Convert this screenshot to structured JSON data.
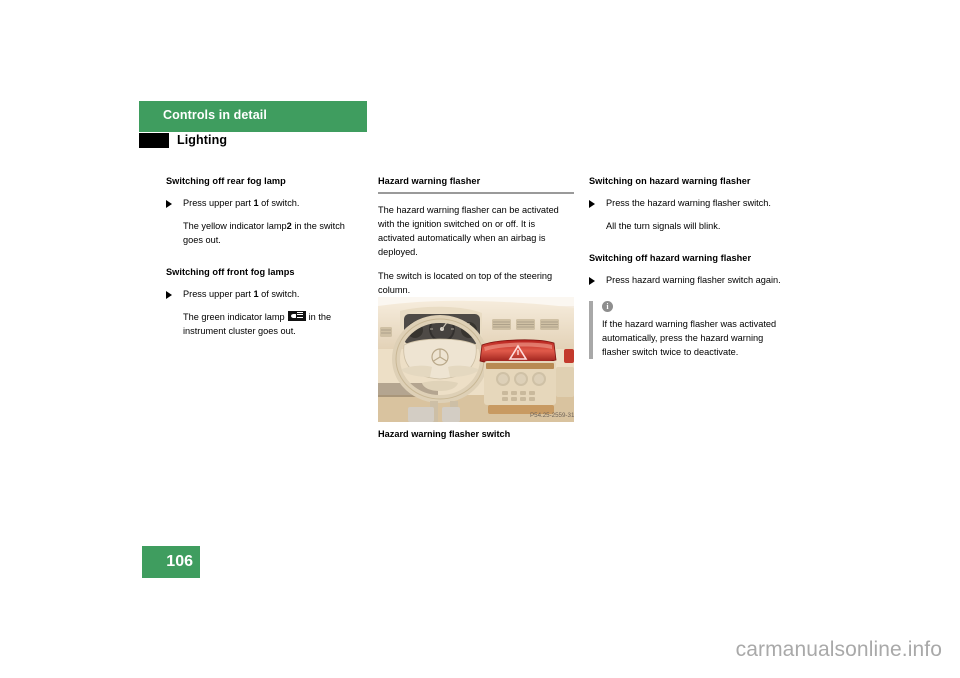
{
  "header": {
    "chapter_title": "Controls in detail",
    "section_title": "Lighting",
    "green": "#3f9d5f"
  },
  "left_column": {
    "heading_1": "Switching off rear fog lamp",
    "bullet_1_pre": "Press upper part ",
    "bullet_1_num": "1",
    "bullet_1_post": " of switch.",
    "result_1_pre": "The yellow indicator lamp",
    "result_1_num": "2",
    "result_1_post": " in the switch goes out.",
    "heading_2": "Switching off front fog lamps",
    "bullet_2_pre": "Press upper part ",
    "bullet_2_num": "1",
    "bullet_2_post": " of switch.",
    "result_2_pre": "The green indicator lamp",
    "result_2_icon": "fog-lamp-indicator-icon",
    "result_2_post": "in the instrument cluster goes out."
  },
  "middle_column": {
    "heading": "Hazard warning flasher",
    "paragraph_1": "The hazard warning flasher can be activated with the ignition switched on or off. It is activated automatically when an airbag is deployed.",
    "paragraph_2": "The switch is located on top of the steering column.",
    "figure_caption": "Hazard warning flasher switch",
    "figure_code": "P54.25-2559-31",
    "figure_alt": "Dashboard view with steering wheel, instrument cluster and red hazard warning flasher switch on top of the center console"
  },
  "right_column": {
    "heading_1": "Switching on hazard warning flasher",
    "bullet_1": "Press the hazard warning flasher switch.",
    "result_1": "All the turn signals will blink.",
    "heading_2": "Switching off hazard warning flasher",
    "bullet_2": "Press hazard warning flasher switch again.",
    "note_icon": "info-icon",
    "note_text": "If the hazard warning flasher was activated automatically, press the hazard warning flasher switch twice to deactivate."
  },
  "footer": {
    "page_number": "106",
    "watermark": "carmanualsonline.info"
  }
}
